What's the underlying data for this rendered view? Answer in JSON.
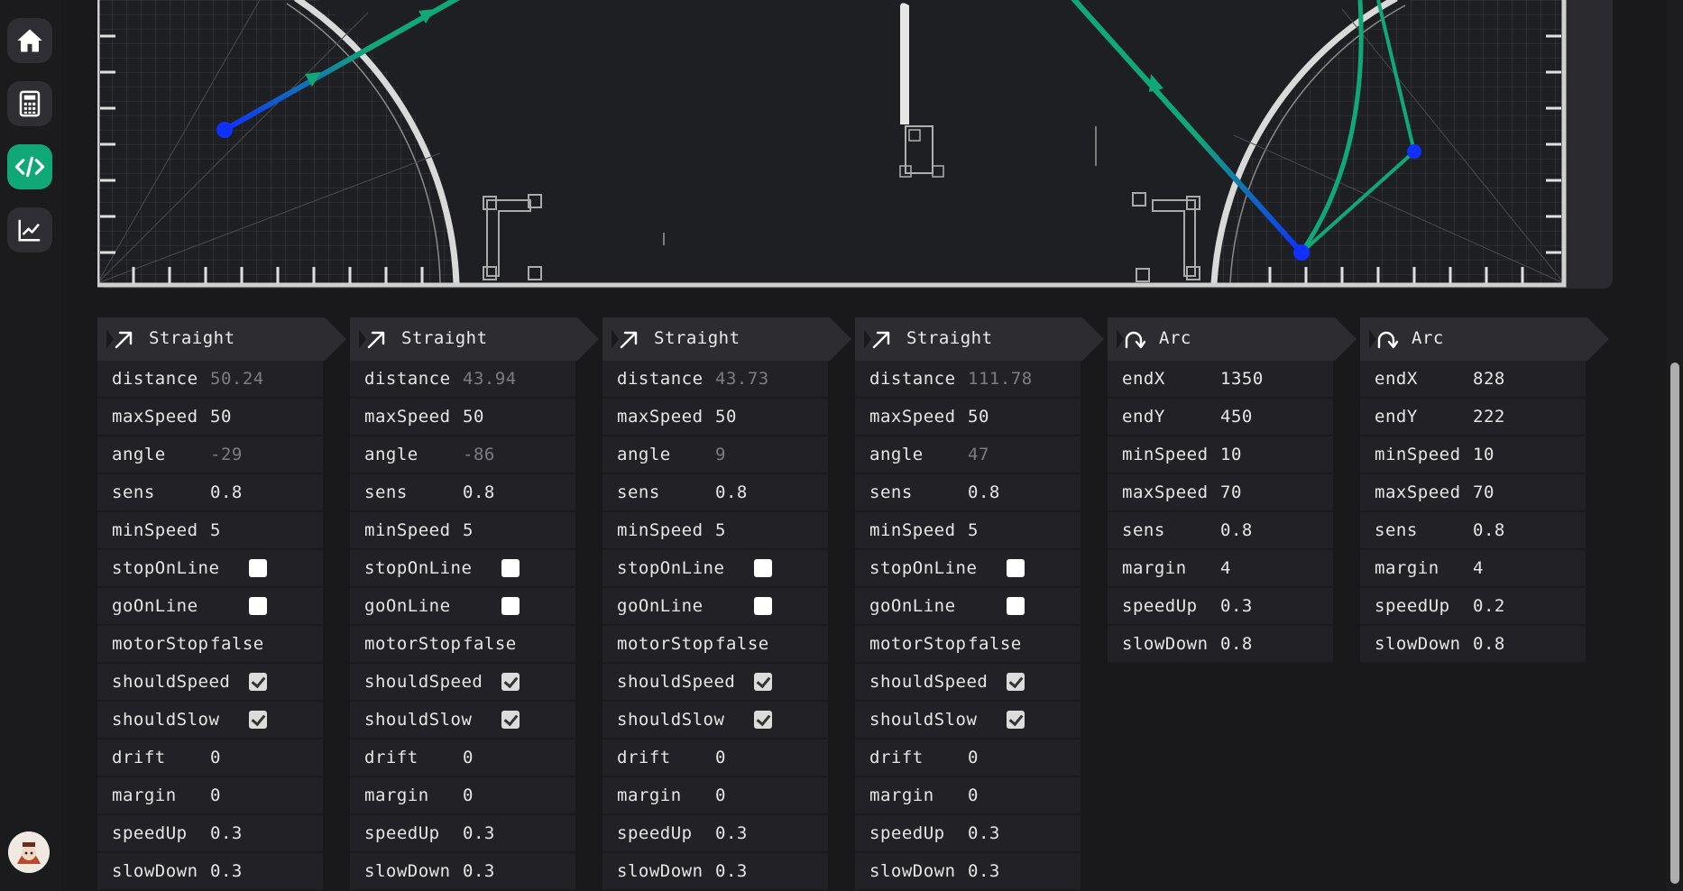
{
  "sidebar": {
    "items": [
      {
        "icon": "home-icon",
        "active": false
      },
      {
        "icon": "calculator-icon",
        "active": false
      },
      {
        "icon": "code-icon",
        "active": true
      },
      {
        "icon": "chart-icon",
        "active": false
      }
    ]
  },
  "colors": {
    "accent": "#10a877",
    "path_blue": "#1030ff",
    "path_green": "#10a877"
  },
  "blocks": [
    {
      "type": "Straight",
      "icon": "arrow-up-right-icon",
      "title": "Straight",
      "params": [
        {
          "label": "distance",
          "value": "50.24",
          "kind": "muted"
        },
        {
          "label": "maxSpeed",
          "value": "50",
          "kind": "text"
        },
        {
          "label": "angle",
          "value": "-29",
          "kind": "muted"
        },
        {
          "label": "sens",
          "value": "0.8",
          "kind": "text"
        },
        {
          "label": "minSpeed",
          "value": "5",
          "kind": "text"
        },
        {
          "label": "stopOnLine",
          "value": false,
          "kind": "checkbox"
        },
        {
          "label": "goOnLine",
          "value": false,
          "kind": "checkbox"
        },
        {
          "label": "motorStop",
          "value": "false",
          "kind": "text"
        },
        {
          "label": "shouldSpeed",
          "value": true,
          "kind": "checkbox"
        },
        {
          "label": "shouldSlow",
          "value": true,
          "kind": "checkbox"
        },
        {
          "label": "drift",
          "value": "0",
          "kind": "text"
        },
        {
          "label": "margin",
          "value": "0",
          "kind": "text"
        },
        {
          "label": "speedUp",
          "value": "0.3",
          "kind": "text"
        },
        {
          "label": "slowDown",
          "value": "0.3",
          "kind": "text"
        }
      ]
    },
    {
      "type": "Straight",
      "icon": "arrow-up-right-icon",
      "title": "Straight",
      "params": [
        {
          "label": "distance",
          "value": "43.94",
          "kind": "muted"
        },
        {
          "label": "maxSpeed",
          "value": "50",
          "kind": "text"
        },
        {
          "label": "angle",
          "value": "-86",
          "kind": "muted"
        },
        {
          "label": "sens",
          "value": "0.8",
          "kind": "text"
        },
        {
          "label": "minSpeed",
          "value": "5",
          "kind": "text"
        },
        {
          "label": "stopOnLine",
          "value": false,
          "kind": "checkbox"
        },
        {
          "label": "goOnLine",
          "value": false,
          "kind": "checkbox"
        },
        {
          "label": "motorStop",
          "value": "false",
          "kind": "text"
        },
        {
          "label": "shouldSpeed",
          "value": true,
          "kind": "checkbox"
        },
        {
          "label": "shouldSlow",
          "value": true,
          "kind": "checkbox"
        },
        {
          "label": "drift",
          "value": "0",
          "kind": "text"
        },
        {
          "label": "margin",
          "value": "0",
          "kind": "text"
        },
        {
          "label": "speedUp",
          "value": "0.3",
          "kind": "text"
        },
        {
          "label": "slowDown",
          "value": "0.3",
          "kind": "text"
        }
      ]
    },
    {
      "type": "Straight",
      "icon": "arrow-up-right-icon",
      "title": "Straight",
      "params": [
        {
          "label": "distance",
          "value": "43.73",
          "kind": "muted"
        },
        {
          "label": "maxSpeed",
          "value": "50",
          "kind": "text"
        },
        {
          "label": "angle",
          "value": "9",
          "kind": "muted"
        },
        {
          "label": "sens",
          "value": "0.8",
          "kind": "text"
        },
        {
          "label": "minSpeed",
          "value": "5",
          "kind": "text"
        },
        {
          "label": "stopOnLine",
          "value": false,
          "kind": "checkbox"
        },
        {
          "label": "goOnLine",
          "value": false,
          "kind": "checkbox"
        },
        {
          "label": "motorStop",
          "value": "false",
          "kind": "text"
        },
        {
          "label": "shouldSpeed",
          "value": true,
          "kind": "checkbox"
        },
        {
          "label": "shouldSlow",
          "value": true,
          "kind": "checkbox"
        },
        {
          "label": "drift",
          "value": "0",
          "kind": "text"
        },
        {
          "label": "margin",
          "value": "0",
          "kind": "text"
        },
        {
          "label": "speedUp",
          "value": "0.3",
          "kind": "text"
        },
        {
          "label": "slowDown",
          "value": "0.3",
          "kind": "text"
        }
      ]
    },
    {
      "type": "Straight",
      "icon": "arrow-up-right-icon",
      "title": "Straight",
      "params": [
        {
          "label": "distance",
          "value": "111.78",
          "kind": "muted"
        },
        {
          "label": "maxSpeed",
          "value": "50",
          "kind": "text"
        },
        {
          "label": "angle",
          "value": "47",
          "kind": "muted"
        },
        {
          "label": "sens",
          "value": "0.8",
          "kind": "text"
        },
        {
          "label": "minSpeed",
          "value": "5",
          "kind": "text"
        },
        {
          "label": "stopOnLine",
          "value": false,
          "kind": "checkbox"
        },
        {
          "label": "goOnLine",
          "value": false,
          "kind": "checkbox"
        },
        {
          "label": "motorStop",
          "value": "false",
          "kind": "text"
        },
        {
          "label": "shouldSpeed",
          "value": true,
          "kind": "checkbox"
        },
        {
          "label": "shouldSlow",
          "value": true,
          "kind": "checkbox"
        },
        {
          "label": "drift",
          "value": "0",
          "kind": "text"
        },
        {
          "label": "margin",
          "value": "0",
          "kind": "text"
        },
        {
          "label": "speedUp",
          "value": "0.3",
          "kind": "text"
        },
        {
          "label": "slowDown",
          "value": "0.3",
          "kind": "text"
        }
      ]
    },
    {
      "type": "Arc",
      "icon": "arc-arrow-icon",
      "title": "Arc",
      "params": [
        {
          "label": "endX",
          "value": "1350",
          "kind": "text"
        },
        {
          "label": "endY",
          "value": "450",
          "kind": "text"
        },
        {
          "label": "minSpeed",
          "value": "10",
          "kind": "text"
        },
        {
          "label": "maxSpeed",
          "value": "70",
          "kind": "text"
        },
        {
          "label": "sens",
          "value": "0.8",
          "kind": "text"
        },
        {
          "label": "margin",
          "value": "4",
          "kind": "text"
        },
        {
          "label": "speedUp",
          "value": "0.3",
          "kind": "text"
        },
        {
          "label": "slowDown",
          "value": "0.8",
          "kind": "text"
        }
      ]
    },
    {
      "type": "Arc",
      "icon": "arc-arrow-icon",
      "title": "Arc",
      "params": [
        {
          "label": "endX",
          "value": "828",
          "kind": "text"
        },
        {
          "label": "endY",
          "value": "222",
          "kind": "text"
        },
        {
          "label": "minSpeed",
          "value": "10",
          "kind": "text"
        },
        {
          "label": "maxSpeed",
          "value": "70",
          "kind": "text"
        },
        {
          "label": "sens",
          "value": "0.8",
          "kind": "text"
        },
        {
          "label": "margin",
          "value": "4",
          "kind": "text"
        },
        {
          "label": "speedUp",
          "value": "0.2",
          "kind": "text"
        },
        {
          "label": "slowDown",
          "value": "0.8",
          "kind": "text"
        }
      ]
    }
  ]
}
